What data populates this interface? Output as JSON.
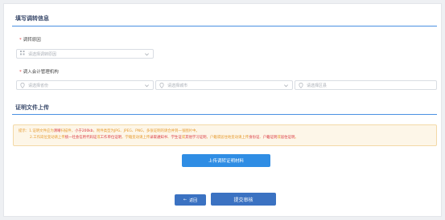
{
  "transfer_section": {
    "title": "填写调转信息",
    "transfer_reason": {
      "label": "调转原因",
      "required_mark": "*",
      "placeholder": "请选择调转原因"
    },
    "destination": {
      "label": "调入会计管理机构",
      "required_mark": "*",
      "province_placeholder": "请选择省份",
      "city_placeholder": "请选择城市",
      "district_placeholder": "请选择区县"
    }
  },
  "proof_section": {
    "title": "证明文件上传",
    "notice": {
      "l1_a": "提示：1.证明文件应为",
      "l1_b": "清晰",
      "l1_c": "扫描件，",
      "l1_d": "小于200kb",
      "l1_e": "，附件类型为JPG、JPEG、PNG，多张证明的请合并到一张图片中。",
      "l2_a": "2.工作岗位变动请上传",
      "l2_b": "统一社会信用代码证",
      "l2_c": "或",
      "l2_d": "工作单位证明",
      "l2_e": "，学籍变动请上传",
      "l2_f": "录取通知书",
      "l2_g": "、",
      "l2_h": "学生证",
      "l2_i": "或",
      "l2_j": "其他学习证明",
      "l2_k": "，户籍或居住地变动请上传",
      "l2_l": "身份证",
      "l2_m": "、",
      "l2_n": "户籍证明",
      "l2_o": "或",
      "l2_p": "居住证明",
      "l2_q": "。"
    },
    "upload_button": "上传调转证明材料"
  },
  "footer": {
    "back_arrow": "←",
    "back_button": "返回",
    "submit_button": "提交审核"
  },
  "colors": {
    "accent": "#2f8de4",
    "primary_button": "#3b72c2",
    "warning": "#e69a2e",
    "danger": "#d9363e"
  },
  "icons": {
    "grid": "grid-icon",
    "location": "location-icon",
    "chevron": "chevron-down-icon"
  }
}
